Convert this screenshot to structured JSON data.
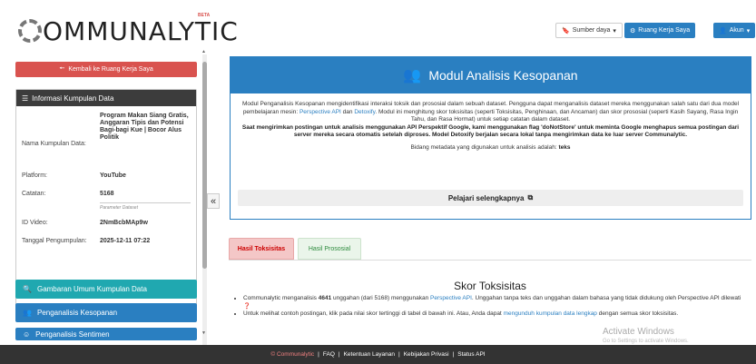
{
  "header": {
    "logo_text": "OMMUNALYTIC",
    "logo_badge": "BETA",
    "sumber_label": "Sumber daya",
    "ruang_label": "Ruang Kerja Saya",
    "akun_label": "Akun"
  },
  "sidebar": {
    "back_label": "Kembali ke Ruang Kerja Saya",
    "info_title": "Informasi Kumpulan Data",
    "rows": {
      "nama_label": "Nama Kumpulan Data:",
      "nama_value": "Program Makan Siang Gratis, Anggaran Tipis dan Potensi Bagi-bagi Kue | Bocor Alus Politik",
      "platform_label": "Platform:",
      "platform_value": "YouTube",
      "catatan_label": "Catatan:",
      "catatan_value": "5168",
      "param_label": "Parameter Dataset",
      "video_label": "ID Video:",
      "video_value": "2NmBcbMAp9w",
      "tanggal_label": "Tanggal Pengumpulan:",
      "tanggal_value": "2025-12-11 07:22"
    },
    "links": [
      {
        "label": "Gambaran Umum Kumpulan Data"
      },
      {
        "label": "Penganalisis Kesopanan"
      },
      {
        "label": "Penganalisis Sentimen"
      }
    ]
  },
  "module": {
    "title": "Modul Analisis Kesopanan",
    "p1": "Modul Penganalisis Kesopanan mengidentifikasi interaksi toksik dan prososial dalam sebuah dataset. Pengguna dapat menganalisis dataset mereka menggunakan salah satu dari dua model pembelajaran mesin:",
    "link_perspective": "Perspective API",
    "and": "dan",
    "link_detoxify": "Detoxify",
    "p1b": ". Modul ini menghitung skor toksisitas (seperti Toksisitas, Penghinaan, dan Ancaman) dan skor prososial (seperti Kasih Sayang, Rasa Ingin Tahu, dan Rasa Hormat) untuk setiap catatan dalam dataset.",
    "p2": "Saat mengirimkan postingan untuk analisis menggunakan API Perspektif Google, kami menggunakan flag 'doNotStore' untuk meminta Google menghapus semua postingan dari server mereka secara otomatis setelah diproses. Model Detoxify berjalan secara lokal tanpa mengirimkan data ke luar server Communalytic.",
    "meta_label": "Bidang metadata yang digunakan untuk analisis adalah:",
    "meta_value": "teks",
    "learn_label": "Pelajari selengkapnya"
  },
  "tabs": {
    "toxicity": "Hasil Toksisitas",
    "prosocial": "Hasil Prososial"
  },
  "toxicity": {
    "title": "Skor Toksisitas",
    "b1_a": "Communalytic menganalisis",
    "b1_count": "4641",
    "b1_b": "unggahan (dari 5168) menggunakan",
    "b1_link": "Perspective API",
    "b1_c": ". Unggahan tanpa teks dan unggahan dalam bahasa yang tidak didukung oleh Perspective API dilewati",
    "b2_a": "Untuk melihat contoh postingan, klik pada nilai skor tertinggi di tabel di bawah ini. Atau, Anda dapat",
    "b2_link": "mengunduh kumpulan data lengkap",
    "b2_b": "dengan semua skor toksisitas."
  },
  "footer": {
    "brand": "© Communalytic",
    "faq": "FAQ",
    "terms": "Ketentuan Layanan",
    "privacy": "Kebijakan Privasi",
    "status": "Status API"
  },
  "watermark": {
    "line1": "Activate Windows",
    "line2": "Go to Settings to activate Windows."
  }
}
